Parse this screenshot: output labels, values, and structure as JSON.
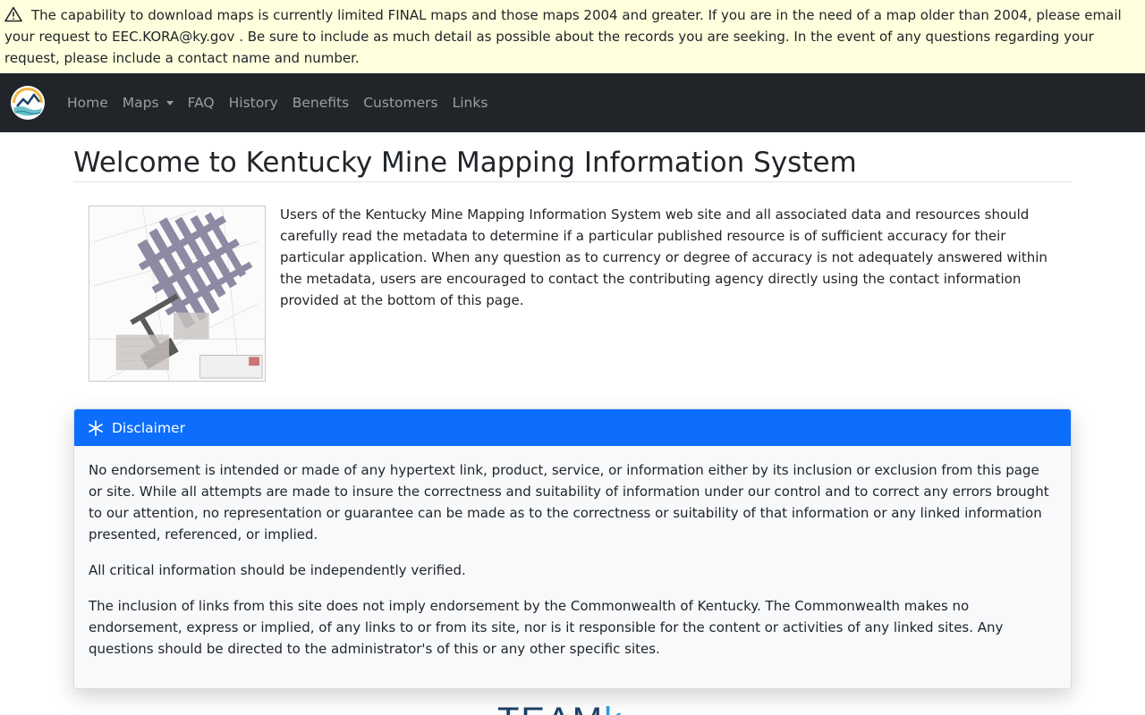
{
  "alert": {
    "icon": "warning-triangle-icon",
    "text": "The capability to download maps is currently limited FINAL maps and those maps 2004 and greater. If you are in the need of a map older than 2004, please email your request to EEC.KORA@ky.gov . Be sure to include as much detail as possible about the records you are seeking. In the event of any questions regarding your request, please include a contact name and number."
  },
  "nav": {
    "items": [
      {
        "label": "Home"
      },
      {
        "label": "Maps"
      },
      {
        "label": "FAQ"
      },
      {
        "label": "History"
      },
      {
        "label": "Benefits"
      },
      {
        "label": "Customers"
      },
      {
        "label": "Links"
      }
    ]
  },
  "page": {
    "title": "Welcome to Kentucky Mine Mapping Information System",
    "intro": "Users of the Kentucky Mine Mapping Information System web site and all associated data and resources should carefully read the metadata to determine if a particular published resource is of sufficient accuracy for their particular application. When any question as to currency or degree of accuracy is not adequately answered within the metadata, users are encouraged to contact the contributing agency directly using the contact information provided at the bottom of this page."
  },
  "disclaimer": {
    "title": "Disclaimer",
    "paragraphs": [
      "No endorsement is intended or made of any hypertext link, product, service, or information either by its inclusion or exclusion from this page or site. While all attempts are made to insure the correctness and suitability of information under our control and to correct any errors brought to our attention, no representation or guarantee can be made as to the correctness or suitability of that information or any linked information presented, referenced, or implied.",
      "All critical information should be independently verified.",
      "The inclusion of links from this site does not imply endorsement by the Commonwealth of Kentucky. The Commonwealth makes no endorsement, express or implied, of any links to or from its site, nor is it responsible for the content or activities of any linked sites. Any questions should be directed to the administrator's of this or any other specific sites."
    ]
  },
  "footer": {
    "logo_main": "TEAM",
    "logo_accent": "k"
  },
  "colors": {
    "alert_bg": "#ffffdd",
    "navbar_bg": "#212529",
    "card_header": "#0d6efd"
  }
}
